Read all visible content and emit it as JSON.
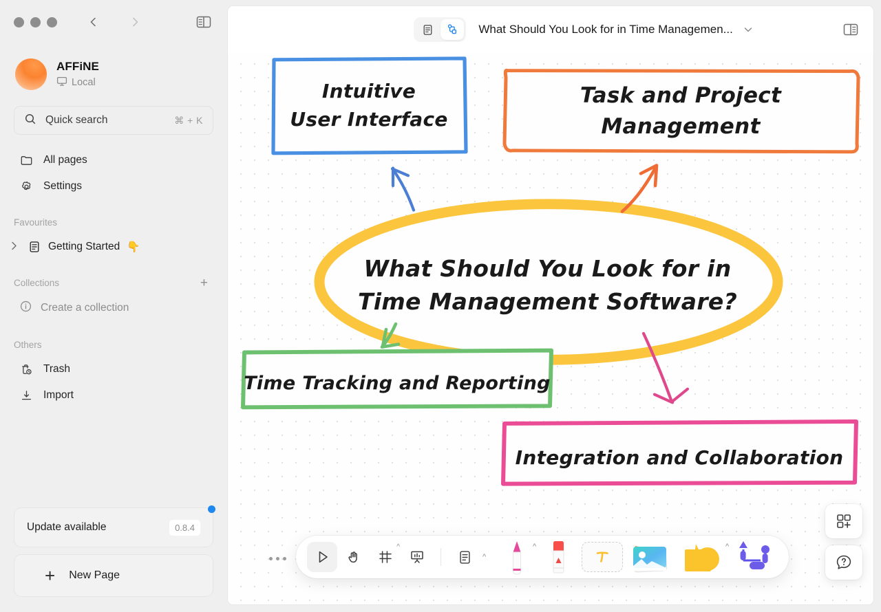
{
  "window": {
    "traffic_lights": [
      "close",
      "minimize",
      "zoom"
    ],
    "nav_back": "back-icon",
    "nav_forward": "forward-icon",
    "sidebar_toggle": "sidebar-toggle-icon"
  },
  "sidebar": {
    "workspace": {
      "name": "AFFiNE",
      "sync_label": "Local",
      "sync_icon": "monitor-icon"
    },
    "search": {
      "placeholder": "Quick search",
      "shortcut": "⌘ + K",
      "icon": "search-icon"
    },
    "nav": [
      {
        "label": "All pages",
        "icon": "folder-icon"
      },
      {
        "label": "Settings",
        "icon": "gear-icon"
      }
    ],
    "favourites": {
      "title": "Favourites",
      "items": [
        {
          "label": "Getting Started",
          "emoji": "👇",
          "icon": "doc-icon",
          "caret": "›"
        }
      ]
    },
    "collections": {
      "title": "Collections",
      "add_icon": "plus-icon",
      "empty_label": "Create a collection",
      "empty_icon": "info-icon"
    },
    "others": {
      "title": "Others",
      "items": [
        {
          "label": "Trash",
          "icon": "trash-clock-icon"
        },
        {
          "label": "Import",
          "icon": "download-icon"
        }
      ]
    },
    "update": {
      "label": "Update available",
      "version": "0.8.4",
      "badge_color": "#1e88f0"
    },
    "new_page": {
      "label": "New Page",
      "icon": "plus-icon"
    }
  },
  "header": {
    "mode_page": "page-mode-icon",
    "mode_edgeless": "edgeless-mode-icon",
    "active_mode": "edgeless",
    "title": "What Should You Look for in Time Managemen...",
    "title_caret": "chevron-down-icon",
    "right_panel_toggle": "right-sidebar-toggle-icon"
  },
  "canvas": {
    "nodes": [
      {
        "id": "blue",
        "text": "Intuitive\nUser Interface",
        "color": "#4a90e2"
      },
      {
        "id": "orange",
        "text": "Task and Project Management",
        "color": "#f07a3c"
      },
      {
        "id": "center",
        "text": "What Should You Look for in\nTime Management Software?",
        "color": "#fcc53e"
      },
      {
        "id": "green",
        "text": "Time Tracking and Reporting",
        "color": "#6ec071"
      },
      {
        "id": "pink",
        "text": "Integration and Collaboration",
        "color": "#ea4c96"
      }
    ],
    "arrows": [
      {
        "id": "to-blue",
        "color": "#4a7fd4",
        "direction": "up-left"
      },
      {
        "id": "to-orange",
        "color": "#ef6c35",
        "direction": "up-right"
      },
      {
        "id": "to-green",
        "color": "#6ec071",
        "direction": "down-left"
      },
      {
        "id": "to-pink",
        "color": "#e0488c",
        "direction": "down-right"
      }
    ]
  },
  "toolbar": {
    "more_icon": "more-dots-icon",
    "buttons": [
      {
        "name": "select-tool",
        "icon": "cursor-triangle-icon",
        "active": true,
        "caret": false
      },
      {
        "name": "hand-tool",
        "icon": "hand-icon",
        "active": false,
        "caret": false
      },
      {
        "name": "frame-tool",
        "icon": "frame-icon",
        "active": false,
        "caret": true
      },
      {
        "name": "present-tool",
        "icon": "presentation-icon",
        "active": false,
        "caret": false
      },
      {
        "name": "note-tool",
        "icon": "note-icon",
        "active": false,
        "caret": true
      }
    ],
    "tools": [
      {
        "name": "pen-tool",
        "icon": "pen-icon",
        "caret": true
      },
      {
        "name": "eraser-tool",
        "icon": "eraser-icon",
        "caret": false
      },
      {
        "name": "text-tool",
        "icon": "text-t-icon",
        "caret": false
      },
      {
        "name": "image-tool",
        "icon": "image-icon",
        "caret": false
      },
      {
        "name": "shape-tool",
        "icon": "shapes-icon",
        "caret": true
      },
      {
        "name": "connector-tool",
        "icon": "connector-icon",
        "caret": false
      }
    ]
  },
  "fab": [
    {
      "name": "add-template-button",
      "icon": "squares-plus-icon"
    },
    {
      "name": "help-button",
      "icon": "question-bubble-icon"
    }
  ]
}
